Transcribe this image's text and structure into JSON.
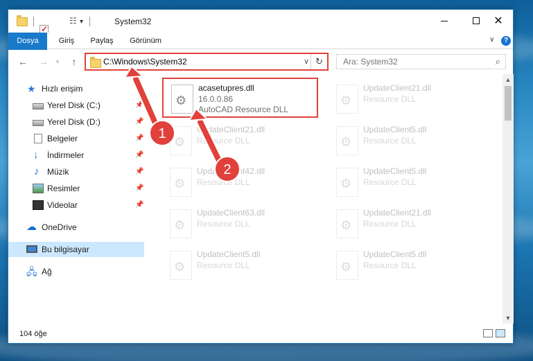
{
  "window": {
    "title": "System32"
  },
  "ribbon": {
    "tabs": [
      {
        "label": "Dosya"
      },
      {
        "label": "Giriş"
      },
      {
        "label": "Paylaş"
      },
      {
        "label": "Görünüm"
      }
    ],
    "help_label": "?"
  },
  "navbar": {
    "address": "C:\\Windows\\System32",
    "search_placeholder": "Ara: System32"
  },
  "sidebar": {
    "items": [
      {
        "label": "Hızlı erişim",
        "icon": "star-icon"
      },
      {
        "label": "Yerel Disk (C:)",
        "icon": "disk-icon",
        "pinned": true
      },
      {
        "label": "Yerel Disk (D:)",
        "icon": "disk-icon",
        "pinned": true
      },
      {
        "label": "Belgeler",
        "icon": "document-icon",
        "pinned": true
      },
      {
        "label": "İndirmeler",
        "icon": "download-icon",
        "pinned": true
      },
      {
        "label": "Müzik",
        "icon": "music-icon",
        "pinned": true
      },
      {
        "label": "Resimler",
        "icon": "picture-icon",
        "pinned": true
      },
      {
        "label": "Videolar",
        "icon": "video-icon",
        "pinned": true
      },
      {
        "label": "OneDrive",
        "icon": "cloud-icon"
      },
      {
        "label": "Bu bilgisayar",
        "icon": "computer-icon",
        "selected": true
      },
      {
        "label": "Ağ",
        "icon": "network-icon"
      }
    ]
  },
  "files": [
    {
      "name": "acasetupres.dll",
      "meta1": "16.0.0.86",
      "meta2": "AutoCAD Resource DLL",
      "highlight": true
    },
    {
      "name": "UpdateClient21.dll",
      "meta1": "Resource DLL"
    },
    {
      "name": "UpdateClient21.dll",
      "meta1": "Resource DLL"
    },
    {
      "name": "UpdateClient5.dll",
      "meta1": "Resource DLL"
    },
    {
      "name": "UpdateClient42.dll",
      "meta1": "Resource DLL"
    },
    {
      "name": "UpdateClient5.dll",
      "meta1": "Resource DLL"
    },
    {
      "name": "UpdateClient63.dll",
      "meta1": "Resource DLL"
    },
    {
      "name": "UpdateClient21.dll",
      "meta1": "Resource DLL"
    },
    {
      "name": "UpdateClient5.dll",
      "meta1": "Resource DLL"
    },
    {
      "name": "UpdateClient5.dll",
      "meta1": "Resource DLL"
    }
  ],
  "status": {
    "item_count": "104 öğe"
  },
  "annotations": {
    "step1": "1",
    "step2": "2",
    "color": "#e0413a"
  }
}
